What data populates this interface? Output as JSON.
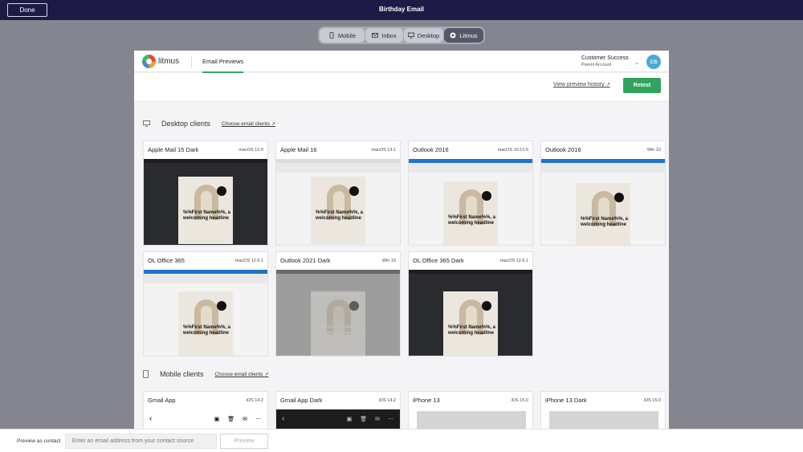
{
  "topbar": {
    "done_label": "Done",
    "title": "Birthday Email"
  },
  "segmented": [
    {
      "label": "Mobile",
      "icon": "mobile-icon",
      "active": false
    },
    {
      "label": "Inbox",
      "icon": "mail-icon",
      "active": false
    },
    {
      "label": "Desktop",
      "icon": "desktop-icon",
      "active": false
    },
    {
      "label": "Litmus",
      "icon": "litmus-icon",
      "active": true
    }
  ],
  "header": {
    "logo_text": "litmus",
    "tab_label": "Email Previews",
    "account_name": "Customer Success",
    "account_sub": "Parent Account",
    "avatar_initials": "CS"
  },
  "actions": {
    "history_label": "View preview history",
    "retest_label": "Retest"
  },
  "desktop_section": {
    "title": "Desktop clients",
    "link": "Choose email clients",
    "cards": [
      {
        "name": "Apple Mail 15 Dark",
        "os": "macOS 12.0",
        "theme": "dark"
      },
      {
        "name": "Apple Mail 16",
        "os": "macOS 13.1",
        "theme": "light"
      },
      {
        "name": "Outlook 2016",
        "os": "macOS 10.12.6",
        "theme": "blue"
      },
      {
        "name": "Outlook 2016",
        "os": "Win 10",
        "theme": "blue"
      },
      {
        "name": "OL Office 365",
        "os": "macOS 12.6.1",
        "theme": "blue"
      },
      {
        "name": "Outlook 2021 Dark",
        "os": "Win 10",
        "theme": "gray"
      },
      {
        "name": "OL Office 365 Dark",
        "os": "macOS 12.6.1",
        "theme": "dark"
      }
    ]
  },
  "mobile_section": {
    "title": "Mobile clients",
    "link": "Choose email clients",
    "cards": [
      {
        "name": "Gmail App",
        "os": "iOS 14.2",
        "theme": "light"
      },
      {
        "name": "Gmail App Dark",
        "os": "iOS 14.2",
        "theme": "dark"
      },
      {
        "name": "iPhone 13",
        "os": "iOS 15.0",
        "theme": "ios"
      },
      {
        "name": "iPhone 13 Dark",
        "os": "iOS 15.0",
        "theme": "ios"
      }
    ]
  },
  "email_preview": {
    "logo_text": "Logo",
    "headline": "%%First Name%%, a welcoming headline"
  },
  "bottom": {
    "preview_label": "Preview as contact",
    "input_placeholder": "Enter an email address from your contact source",
    "preview_button": "Preview"
  },
  "colors": {
    "accent": "#31a35f",
    "topbar": "#1d1a45",
    "backdrop": "#85858f"
  }
}
